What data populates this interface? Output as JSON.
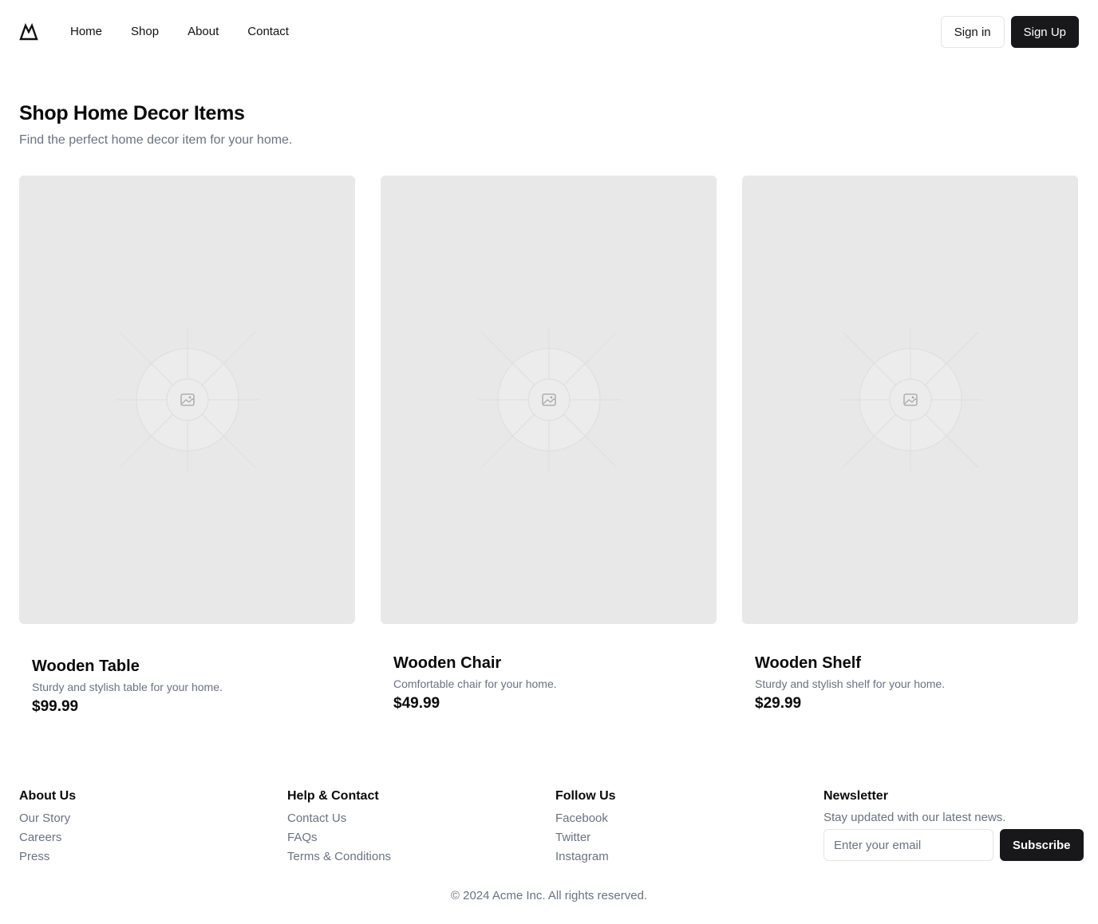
{
  "nav": {
    "logo_icon": "mountain-logo-icon",
    "links": [
      "Home",
      "Shop",
      "About",
      "Contact"
    ],
    "sign_in": "Sign in",
    "sign_up": "Sign Up"
  },
  "hero": {
    "title": "Shop Home Decor Items",
    "subtitle": "Find the perfect home decor item for your home."
  },
  "products": [
    {
      "name": "Wooden Table",
      "description": "Sturdy and stylish table for your home.",
      "price": "$99.99",
      "image_icon": "image-placeholder-icon"
    },
    {
      "name": "Wooden Chair",
      "description": "Comfortable chair for your home.",
      "price": "$49.99",
      "image_icon": "image-placeholder-icon"
    },
    {
      "name": "Wooden Shelf",
      "description": "Sturdy and stylish shelf for your home.",
      "price": "$29.99",
      "image_icon": "image-placeholder-icon"
    }
  ],
  "footer": {
    "about": {
      "title": "About Us",
      "links": [
        "Our Story",
        "Careers",
        "Press"
      ]
    },
    "help": {
      "title": "Help & Contact",
      "links": [
        "Contact Us",
        "FAQs",
        "Terms & Conditions"
      ]
    },
    "follow": {
      "title": "Follow Us",
      "links": [
        "Facebook",
        "Twitter",
        "Instagram"
      ]
    },
    "newsletter": {
      "title": "Newsletter",
      "text": "Stay updated with our latest news.",
      "placeholder": "Enter your email",
      "button": "Subscribe"
    },
    "copyright": "© 2024 Acme Inc. All rights reserved."
  },
  "colors": {
    "primary_button": "#18181b",
    "image_placeholder": "#e8e8e8",
    "muted_text": "#6b7280"
  }
}
